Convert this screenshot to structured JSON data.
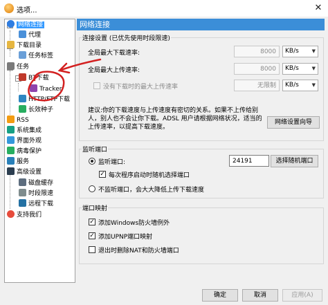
{
  "window": {
    "title": "选项...",
    "close_glyph": "✕"
  },
  "tree": {
    "items": [
      {
        "label": "网络连接",
        "icon": "globe-icon",
        "color": "#2f7de1"
      },
      {
        "label": "代理",
        "icon": "proxy-icon",
        "color": "#4a90d9"
      },
      {
        "label": "下载目录",
        "icon": "folder-icon",
        "color": "#e6b640"
      },
      {
        "label": "任务标签",
        "icon": "tag-icon",
        "color": "#6a9fd8"
      },
      {
        "label": "任务",
        "icon": "task-icon",
        "color": "#7a7a7a"
      },
      {
        "label": "BT下载",
        "icon": "bt-cube-icon",
        "color": "#c0392b"
      },
      {
        "label": "Tracker",
        "icon": "tracker-icon",
        "color": "#8e44ad"
      },
      {
        "label": "HTTP/FTP下载",
        "icon": "http-icon",
        "color": "#2e86c1"
      },
      {
        "label": "长效种子",
        "icon": "seed-icon",
        "color": "#27ae60"
      },
      {
        "label": "RSS",
        "icon": "rss-icon",
        "color": "#f39c12"
      },
      {
        "label": "系统集成",
        "icon": "integration-icon",
        "color": "#16a085"
      },
      {
        "label": "界面外观",
        "icon": "appearance-icon",
        "color": "#3498db"
      },
      {
        "label": "病毒保护",
        "icon": "shield-icon",
        "color": "#27ae60"
      },
      {
        "label": "服务",
        "icon": "service-icon",
        "color": "#2980b9"
      },
      {
        "label": "高级设置",
        "icon": "advanced-icon",
        "color": "#2c3e50"
      },
      {
        "label": "磁盘缓存",
        "icon": "disk-icon",
        "color": "#5d6d7e"
      },
      {
        "label": "时段限速",
        "icon": "clock-icon",
        "color": "#7f8c8d"
      },
      {
        "label": "远程下载",
        "icon": "remote-icon",
        "color": "#2471a3"
      },
      {
        "label": "支持我们",
        "icon": "heart-icon",
        "color": "#e74c3c"
      }
    ]
  },
  "panel": {
    "header": "网络连接",
    "conn": {
      "title": "连接设置 (已优先使用时段限速)",
      "max_down_label": "全局最大下载速率:",
      "max_down_value": "8000",
      "max_up_label": "全局最大上传速率:",
      "max_up_value": "8000",
      "no_task_label": "没有下载时的最大上传速率",
      "no_task_value": "无限制",
      "unit": "KB/s",
      "advice": "建议:你的下载速度与上传速度有密切的关系。如果不上传给别人，别人也不会让你下载。ADSL 用户请根据网络状况，适当的上传速率，以提高下载速度。",
      "wizard_button": "网络设置向导"
    },
    "listen": {
      "title": "监听端口",
      "port_radio_label": "监听端口:",
      "port_value": "24191",
      "random_button": "选择随机端口",
      "random_on_start_label": "每次程序启动时随机选择端口",
      "no_listen_label": "不监听端口，会大大降低上传下载速度"
    },
    "mapping": {
      "title": "端口映射",
      "firewall_label": "添加Windows防火墙例外",
      "upnp_label": "添加UPNP端口映射",
      "remove_nat_label": "退出时删除NAT和防火墙端口"
    }
  },
  "footer": {
    "ok": "确定",
    "cancel": "取消",
    "apply": "应用(A)"
  },
  "colors": {
    "header_bg": "#3b8ed8",
    "selection": "#3399ff",
    "annotation": "#d32020"
  }
}
